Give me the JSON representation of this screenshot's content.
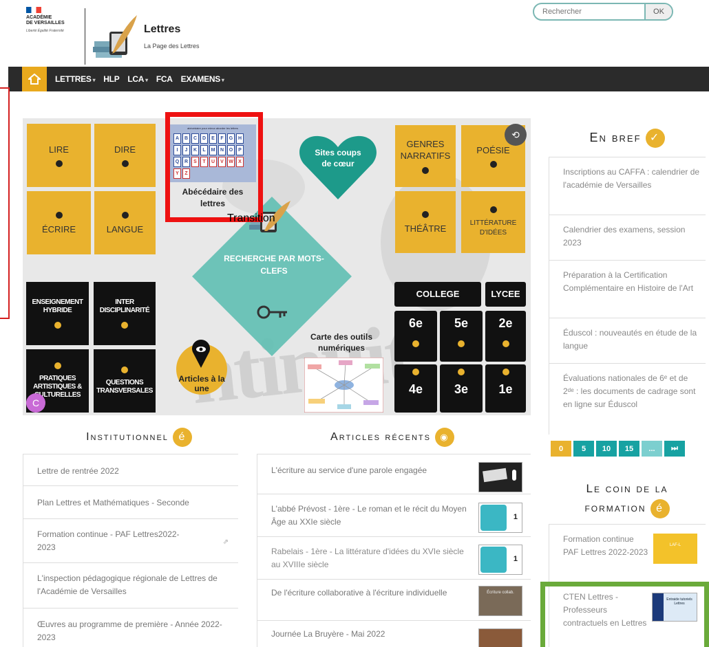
{
  "header": {
    "academy_line1": "ACADÉMIE",
    "academy_line2": "DE VERSAILLES",
    "academy_motto": "Liberté Égalité Fraternité",
    "site_title": "Lettres",
    "site_subtitle": "La Page des Lettres",
    "search_placeholder": "Rechercher",
    "search_button": "OK"
  },
  "nav": {
    "items": [
      {
        "label": "LETTRES",
        "dropdown": true
      },
      {
        "label": "HLP",
        "dropdown": false
      },
      {
        "label": "LCA",
        "dropdown": true
      },
      {
        "label": "FCA",
        "dropdown": false
      },
      {
        "label": "EXAMENS",
        "dropdown": true
      }
    ]
  },
  "banner": {
    "tiles_left": [
      "LIRE",
      "DIRE",
      "ÉCRIRE",
      "LANGUE"
    ],
    "tiles_right": [
      "GENRES NARRATIFS",
      "POÉSIE",
      "THÉÂTRE",
      "LITTÉRATURE D'IDÉES"
    ],
    "black_tiles": [
      "ENSEIGNEMENT HYBRIDE",
      "INTER DISCIPLINARITÉ",
      "PRATIQUES ARTISTIQUES & CULTURELLES",
      "QUESTIONS TRANSVERSALES"
    ],
    "abecedaire_header": "abécédaire pour mieux aborder les lettres",
    "abecedaire_letters": [
      "A",
      "B",
      "C",
      "D",
      "E",
      "F",
      "G",
      "H",
      "I",
      "J",
      "K",
      "L",
      "M",
      "N",
      "O",
      "P",
      "Q",
      "R",
      "S",
      "T",
      "U",
      "V",
      "W",
      "X",
      "Y",
      "Z"
    ],
    "abecedaire_label": "Abécédaire des lettres",
    "transition_label": "Transition",
    "heart_label": "Sites coups de cœur",
    "recherche_label": "RECHERCHE PAR MOTS-CLEFS",
    "carte_label": "Carte des outils numériques",
    "articles_label": "Articles à la une",
    "watermark": "ntinuit agog",
    "college_label": "COLLEGE",
    "lycee_label": "LYCEE",
    "grades": [
      "6e",
      "5e",
      "2e",
      "4e",
      "3e",
      "1e"
    ]
  },
  "en_bref": {
    "title": "En bref",
    "badge": "✓",
    "items": [
      "Inscriptions au CAFFA : calendrier de l'académie de Versailles",
      "Calendrier des examens, session 2023",
      "Préparation à la Certification Complémentaire en Histoire de l'Art",
      "Éduscol : nouveautés en étude de la langue",
      "Évaluations nationales de 6ᵉ et de 2ᵈᵉ : les documents de cadrage sont en ligne sur Éduscol"
    ]
  },
  "pager": [
    "0",
    "5",
    "10",
    "15",
    "...",
    "⏭"
  ],
  "coin_formation": {
    "title_line1": "Le coin de la",
    "title_line2": "formation",
    "badge": "é",
    "items": [
      "Formation continue PAF Lettres 2022-2023",
      "CTEN Lettres - Professeurs contractuels en Lettres"
    ],
    "thumb1_text": "LAF-L",
    "thumb2_text": "Entraide tutoriels Lettres"
  },
  "institutionnel": {
    "title": "Institutionnel",
    "badge": "é",
    "items": [
      "Lettre de rentrée 2022",
      "Plan Lettres et Mathématiques - Seconde",
      "Formation continue - PAF Lettres2022-2023",
      "L'inspection pédagogique régionale de Lettres de l'Académie de Versailles",
      "Œuvres au programme de première - Année 2022-2023"
    ]
  },
  "articles_recents": {
    "title": "Articles récents",
    "items": [
      "L'écriture au service d'une parole engagée",
      "L'abbé Prévost - 1ère - Le roman et le récit du Moyen Âge au XXIe siècle",
      "Rabelais - 1ère - La littérature d'idées du XVIe siècle au XVIIIe siècle",
      "De l'écriture collaborative à l'écriture individuelle",
      "Journée La Bruyère - Mai 2022"
    ],
    "thumb_texts": [
      "",
      "1",
      "1",
      "Écriture collab.",
      ""
    ]
  },
  "colors": {
    "accent_yellow": "#e9b22e",
    "teal": "#17a2a2",
    "nav_dark": "#2b2b2b",
    "highlight_red": "#e11111",
    "highlight_green": "#6aaa3a"
  }
}
